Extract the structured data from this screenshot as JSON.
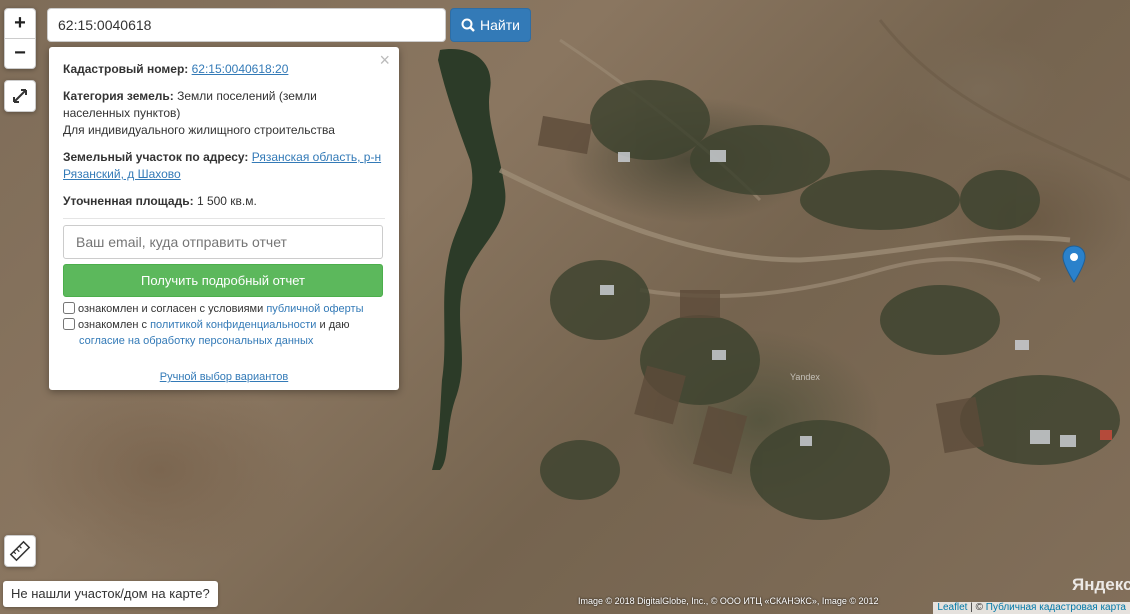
{
  "search": {
    "value": "62:15:0040618",
    "button_label": "Найти"
  },
  "zoom": {
    "in_label": "+",
    "out_label": "−"
  },
  "popup": {
    "close_glyph": "×",
    "cadastral_label": "Кадастровый номер:",
    "cadastral_value": "62:15:0040618:20",
    "category_label": "Категория земель:",
    "category_value": "Земли поселений (земли населенных пунктов)",
    "usage": "Для индивидуального жилищного строительства",
    "address_label": "Земельный участок по адресу:",
    "address_value": "Рязанская область, р-н Рязанский, д Шахово",
    "area_label": "Уточненная площадь:",
    "area_value": "1 500 кв.м.",
    "email_placeholder": "Ваш email, куда отправить отчет",
    "report_button": "Получить подробный отчет",
    "agree1_text": "ознакомлен и согласен с условиями ",
    "agree1_link": "публичной оферты",
    "agree2_text": "ознакомлен с ",
    "agree2_link": "политикой конфиденциальности",
    "agree2_text2": " и даю",
    "agree2_link2": "согласие на обработку персональных данных",
    "manual_link": "Ручной выбор вариантов"
  },
  "not_found_button": "Не нашли участок/дом на карте?",
  "attribution": "Image © 2018 DigitalGlobe, Inc., © ООО ИТЦ «СКАНЭКС», Image © 2012",
  "leaflet": {
    "link": "Leaflet",
    "sep": " | © ",
    "map_link": "Публичная кадастровая карта"
  },
  "map_logo": "Яндекс",
  "map_watermark": "Yandex",
  "colors": {
    "primary": "#337ab7",
    "success": "#5cb85c",
    "marker": "#2a81cb"
  }
}
